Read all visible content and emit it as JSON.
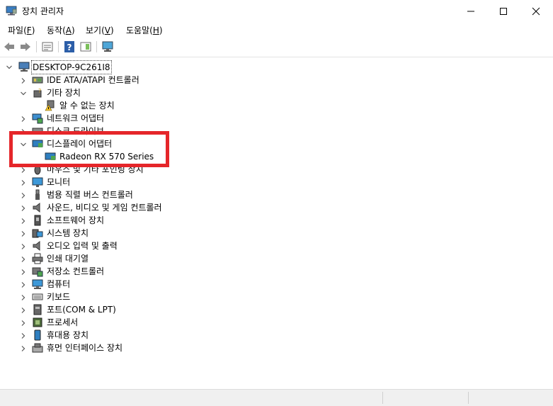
{
  "window": {
    "title": "장치 관리자",
    "icon": "device-manager-icon",
    "buttons": {
      "minimize": "─",
      "maximize": "☐",
      "close": "✕"
    }
  },
  "menu": [
    {
      "label": "파일",
      "accel": "F"
    },
    {
      "label": "동작",
      "accel": "A"
    },
    {
      "label": "보기",
      "accel": "V"
    },
    {
      "label": "도움말",
      "accel": "H"
    }
  ],
  "toolbar": [
    "back-arrow-icon",
    "forward-arrow-icon",
    "properties-icon",
    "help-icon",
    "action-pane-icon",
    "monitor-scan-icon"
  ],
  "tree": {
    "root": "DESKTOP-9C261I8",
    "items": [
      {
        "label": "IDE ATA/ATAPI 컨트롤러",
        "icon": "ide-controller-icon",
        "state": "collapsed"
      },
      {
        "label": "기타 장치",
        "icon": "unknown-device-icon",
        "state": "expanded",
        "children": [
          {
            "label": "알 수 없는 장치",
            "icon": "warning-device-icon"
          }
        ]
      },
      {
        "label": "네트워크 어댑터",
        "icon": "network-adapter-icon",
        "state": "collapsed"
      },
      {
        "label": "디스크 드라이브",
        "icon": "disk-drive-icon",
        "state": "collapsed"
      },
      {
        "label": "디스플레이 어댑터",
        "icon": "display-adapter-icon",
        "state": "expanded",
        "children": [
          {
            "label": "Radeon RX 570 Series",
            "icon": "display-card-icon"
          }
        ]
      },
      {
        "label": "마우스 및 기타 포인팅 장치",
        "icon": "mouse-icon",
        "state": "collapsed"
      },
      {
        "label": "모니터",
        "icon": "monitor-icon",
        "state": "collapsed"
      },
      {
        "label": "범용 직렬 버스 컨트롤러",
        "icon": "usb-icon",
        "state": "collapsed"
      },
      {
        "label": "사운드, 비디오 및 게임 컨트롤러",
        "icon": "speaker-icon",
        "state": "collapsed"
      },
      {
        "label": "소프트웨어 장치",
        "icon": "software-device-icon",
        "state": "collapsed"
      },
      {
        "label": "시스템 장치",
        "icon": "system-device-icon",
        "state": "collapsed"
      },
      {
        "label": "오디오 입력 및 출력",
        "icon": "audio-io-icon",
        "state": "collapsed"
      },
      {
        "label": "인쇄 대기열",
        "icon": "printer-icon",
        "state": "collapsed"
      },
      {
        "label": "저장소 컨트롤러",
        "icon": "storage-controller-icon",
        "state": "collapsed"
      },
      {
        "label": "컴퓨터",
        "icon": "computer-icon",
        "state": "collapsed"
      },
      {
        "label": "키보드",
        "icon": "keyboard-icon",
        "state": "collapsed"
      },
      {
        "label": "포트(COM & LPT)",
        "icon": "port-icon",
        "state": "collapsed"
      },
      {
        "label": "프로세서",
        "icon": "processor-icon",
        "state": "collapsed"
      },
      {
        "label": "휴대용 장치",
        "icon": "portable-device-icon",
        "state": "collapsed"
      },
      {
        "label": "휴먼 인터페이스 장치",
        "icon": "hid-icon",
        "state": "collapsed"
      }
    ]
  },
  "colors": {
    "highlight": "#e5262a",
    "selection": "#cce8ff",
    "chevron": "#555555"
  }
}
